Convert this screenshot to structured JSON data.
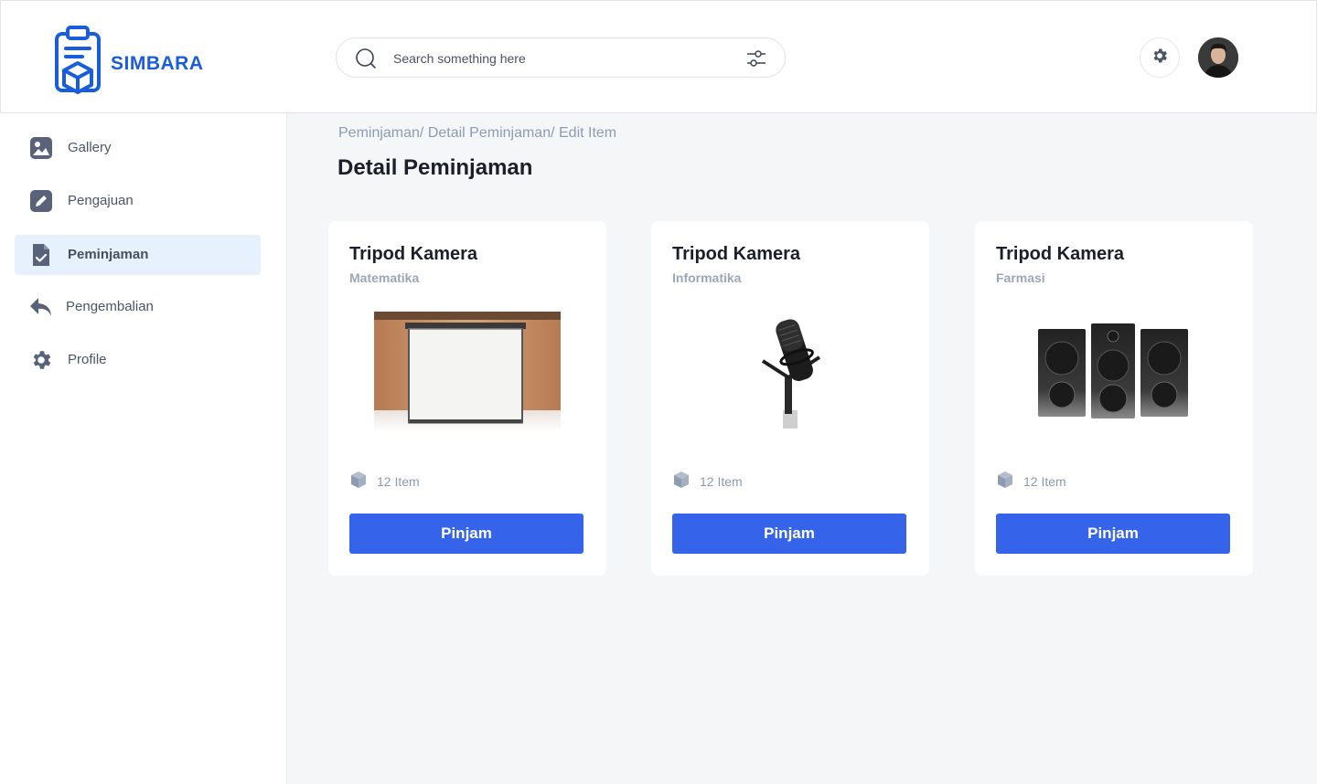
{
  "brand": {
    "name": "SIMBARA",
    "color": "#1a5ddc"
  },
  "search": {
    "placeholder": "Search something here",
    "icon": "search-icon",
    "filter_icon": "sliders-icon"
  },
  "header": {
    "settings_icon": "gear-icon",
    "avatar": "user-avatar"
  },
  "sidebar": {
    "items": [
      {
        "label": "Gallery",
        "icon": "image-icon",
        "active": false
      },
      {
        "label": "Pengajuan",
        "icon": "edit-icon",
        "active": false
      },
      {
        "label": "Peminjaman",
        "icon": "document-check-icon",
        "active": true
      },
      {
        "label": "Pengembalian",
        "icon": "reply-icon",
        "active": false
      },
      {
        "label": "Profile",
        "icon": "gear-icon",
        "active": false
      }
    ]
  },
  "breadcrumb": "Peminjaman/ Detail Peminjaman/ Edit Item",
  "page_title": "Detail Peminjaman",
  "cards": [
    {
      "title": "Tripod Kamera",
      "subtitle": "Matematika",
      "image": "projector-screen",
      "count": "12 Item",
      "button": "Pinjam"
    },
    {
      "title": "Tripod Kamera",
      "subtitle": "Informatika",
      "image": "microphone",
      "count": "12 Item",
      "button": "Pinjam"
    },
    {
      "title": "Tripod Kamera",
      "subtitle": "Farmasi",
      "image": "speakers",
      "count": "12 Item",
      "button": "Pinjam"
    }
  ],
  "colors": {
    "accent": "#3563e9",
    "active_nav_bg": "#e7f1fd",
    "page_bg": "#f5f6f8"
  }
}
